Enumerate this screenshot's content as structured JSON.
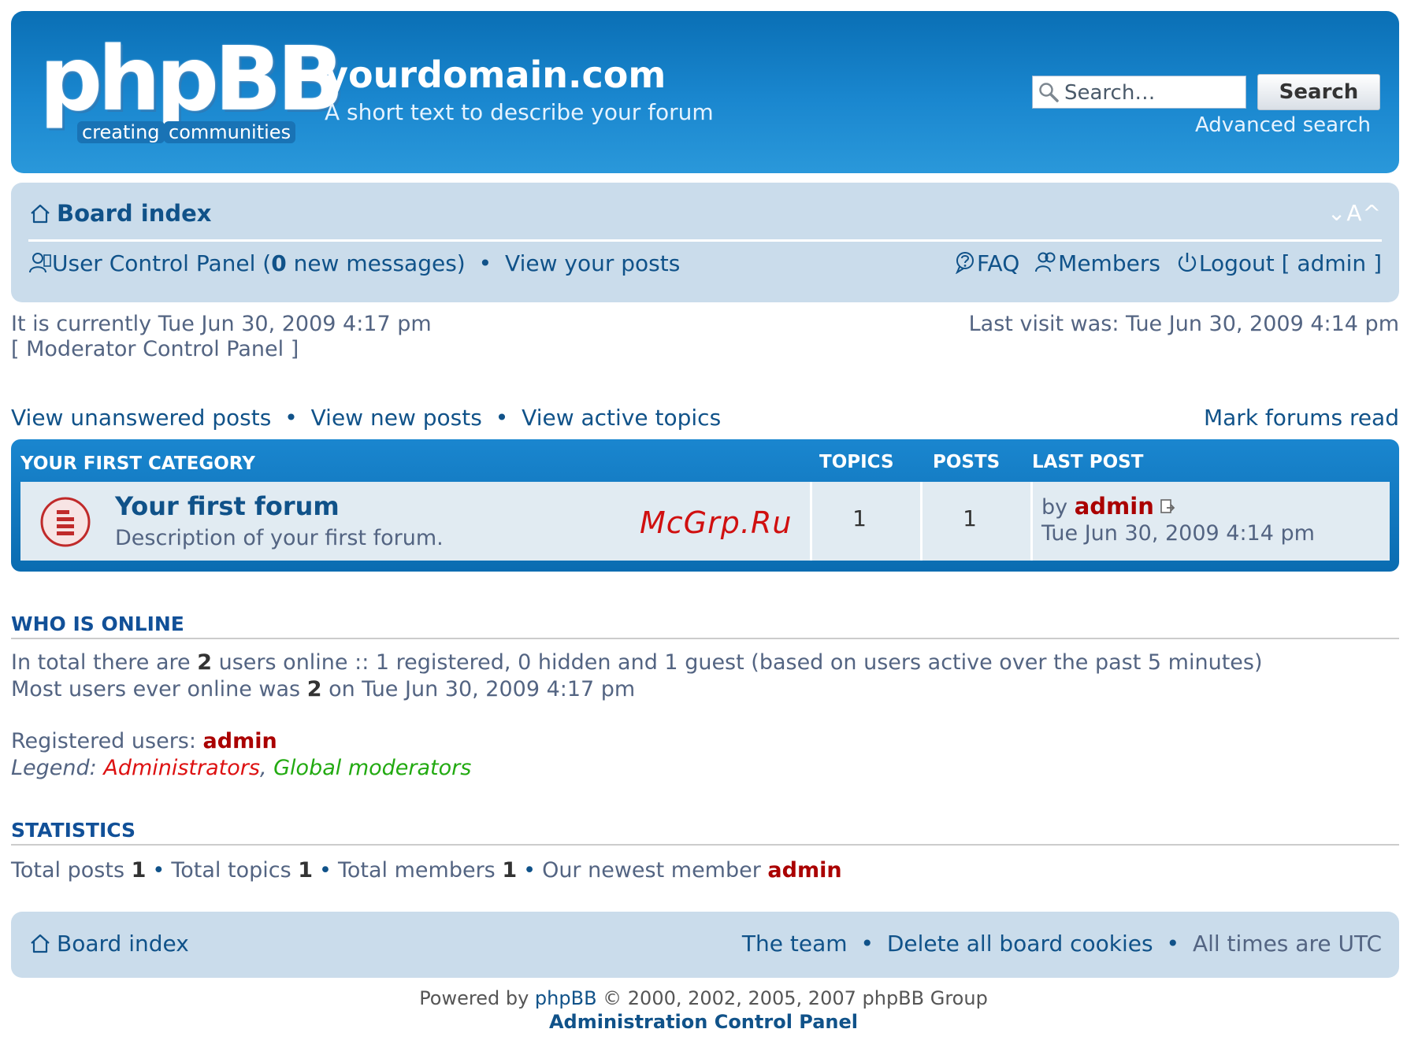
{
  "header": {
    "logo_main": "phpBB",
    "logo_sub_1": "creating",
    "logo_sub_2": "communities",
    "site_title": "yourdomain.com",
    "site_description": "A short text to describe your forum",
    "search_placeholder": "Search…",
    "search_button": "Search",
    "advanced_search": "Advanced search"
  },
  "navbar": {
    "board_index": "Board index",
    "font_size_control": "⌄A^",
    "ucp_prefix": "User Control Panel (",
    "new_messages_count": "0",
    "ucp_suffix": " new messages)",
    "bullet": "•",
    "view_your_posts": "View your posts",
    "faq": "FAQ",
    "members": "Members",
    "logout": "Logout [ admin ]"
  },
  "info": {
    "current_time": "It is currently Tue Jun 30, 2009 4:17 pm",
    "moderator_cp": "[ Moderator Control Panel ]",
    "last_visit": "Last visit was: Tue Jun 30, 2009 4:14 pm",
    "view_unanswered": "View unanswered posts",
    "view_new": "View new posts",
    "view_active": "View active topics",
    "mark_read": "Mark forums read"
  },
  "forum_table": {
    "category": "YOUR FIRST CATEGORY",
    "col_topics": "TOPICS",
    "col_posts": "POSTS",
    "col_last_post": "LAST POST",
    "rows": [
      {
        "title": "Your first forum",
        "description": "Description of your first forum.",
        "topics": "1",
        "posts": "1",
        "last_by": "by ",
        "last_user": "admin",
        "last_time": "Tue Jun 30, 2009 4:14 pm"
      }
    ],
    "watermark": "McGrp.Ru"
  },
  "who_is_online": {
    "title": "WHO IS ONLINE",
    "line1_a": "In total there are ",
    "line1_count": "2",
    "line1_b": " users online :: 1 registered, 0 hidden and 1 guest (based on users active over the past 5 minutes)",
    "line2_a": "Most users ever online was ",
    "line2_count": "2",
    "line2_b": " on Tue Jun 30, 2009 4:17 pm",
    "registered_label": "Registered users: ",
    "registered_user": "admin",
    "legend_label": "Legend: ",
    "legend_admins": "Administrators",
    "legend_sep": ", ",
    "legend_gmods": "Global moderators"
  },
  "statistics": {
    "title": "STATISTICS",
    "posts_label": "Total posts ",
    "posts": "1",
    "topics_label": "Total topics ",
    "topics": "1",
    "members_label": "Total members ",
    "members": "1",
    "newest_label": "Our newest member ",
    "newest_user": "admin"
  },
  "footer": {
    "board_index": "Board index",
    "the_team": "The team",
    "delete_cookies": "Delete all board cookies",
    "timezone": "All times are UTC",
    "powered_a": "Powered by ",
    "powered_link": "phpBB",
    "powered_b": " © 2000, 2002, 2005, 2007 phpBB Group",
    "acp": "Administration Control Panel"
  },
  "colors": {
    "header_blue": "#1a87cf",
    "nav_bg": "#cadceb",
    "link": "#105289",
    "admin_red": "#aa0000",
    "gmod_green": "#22aa11"
  }
}
